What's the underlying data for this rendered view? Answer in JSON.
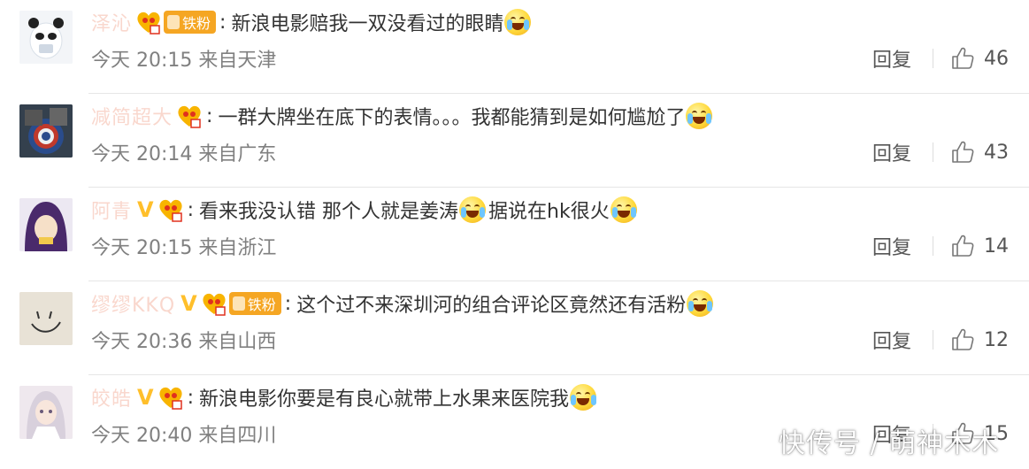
{
  "comments": [
    {
      "username": "泽沁",
      "verified": false,
      "fan_badge": "铁粉",
      "text": "新浪电影赔我一双没看过的眼睛",
      "time": "今天 20:15 来自天津",
      "reply": "回复",
      "likes": "46",
      "emoji": "crying",
      "avatar": "panda-avatar"
    },
    {
      "username": "减简超大",
      "verified": false,
      "fan_badge": "",
      "text": "一群大牌坐在底下的表情。。。我都能猜到是如何尴尬了",
      "time": "今天 20:14 来自广东",
      "reply": "回复",
      "likes": "43",
      "emoji": "laughing",
      "avatar": "shield-avatar"
    },
    {
      "username": "阿青",
      "verified": true,
      "fan_badge": "",
      "text": "看来我没认错 那个人就是姜涛",
      "text2": "据说在hk很火",
      "time": "今天 20:15 来自浙江",
      "reply": "回复",
      "likes": "14",
      "emoji": "laughing",
      "avatar": "anime-avatar"
    },
    {
      "username": "缪缪KKQ",
      "verified": true,
      "fan_badge": "铁粉",
      "text": "这个过不来深圳河的组合评论区竟然还有活粉",
      "time": "今天 20:36 来自山西",
      "reply": "回复",
      "likes": "12",
      "emoji": "laughing",
      "avatar": "smiley-avatar"
    },
    {
      "username": "皎皓",
      "verified": true,
      "fan_badge": "",
      "text": "新浪电影你要是有良心就带上水果来医院我",
      "time": "今天 20:40 来自四川",
      "reply": "回复",
      "likes": "15",
      "emoji": "happy-crying",
      "avatar": "girl-avatar"
    }
  ],
  "watermark": "快传号 / 萌神木木"
}
